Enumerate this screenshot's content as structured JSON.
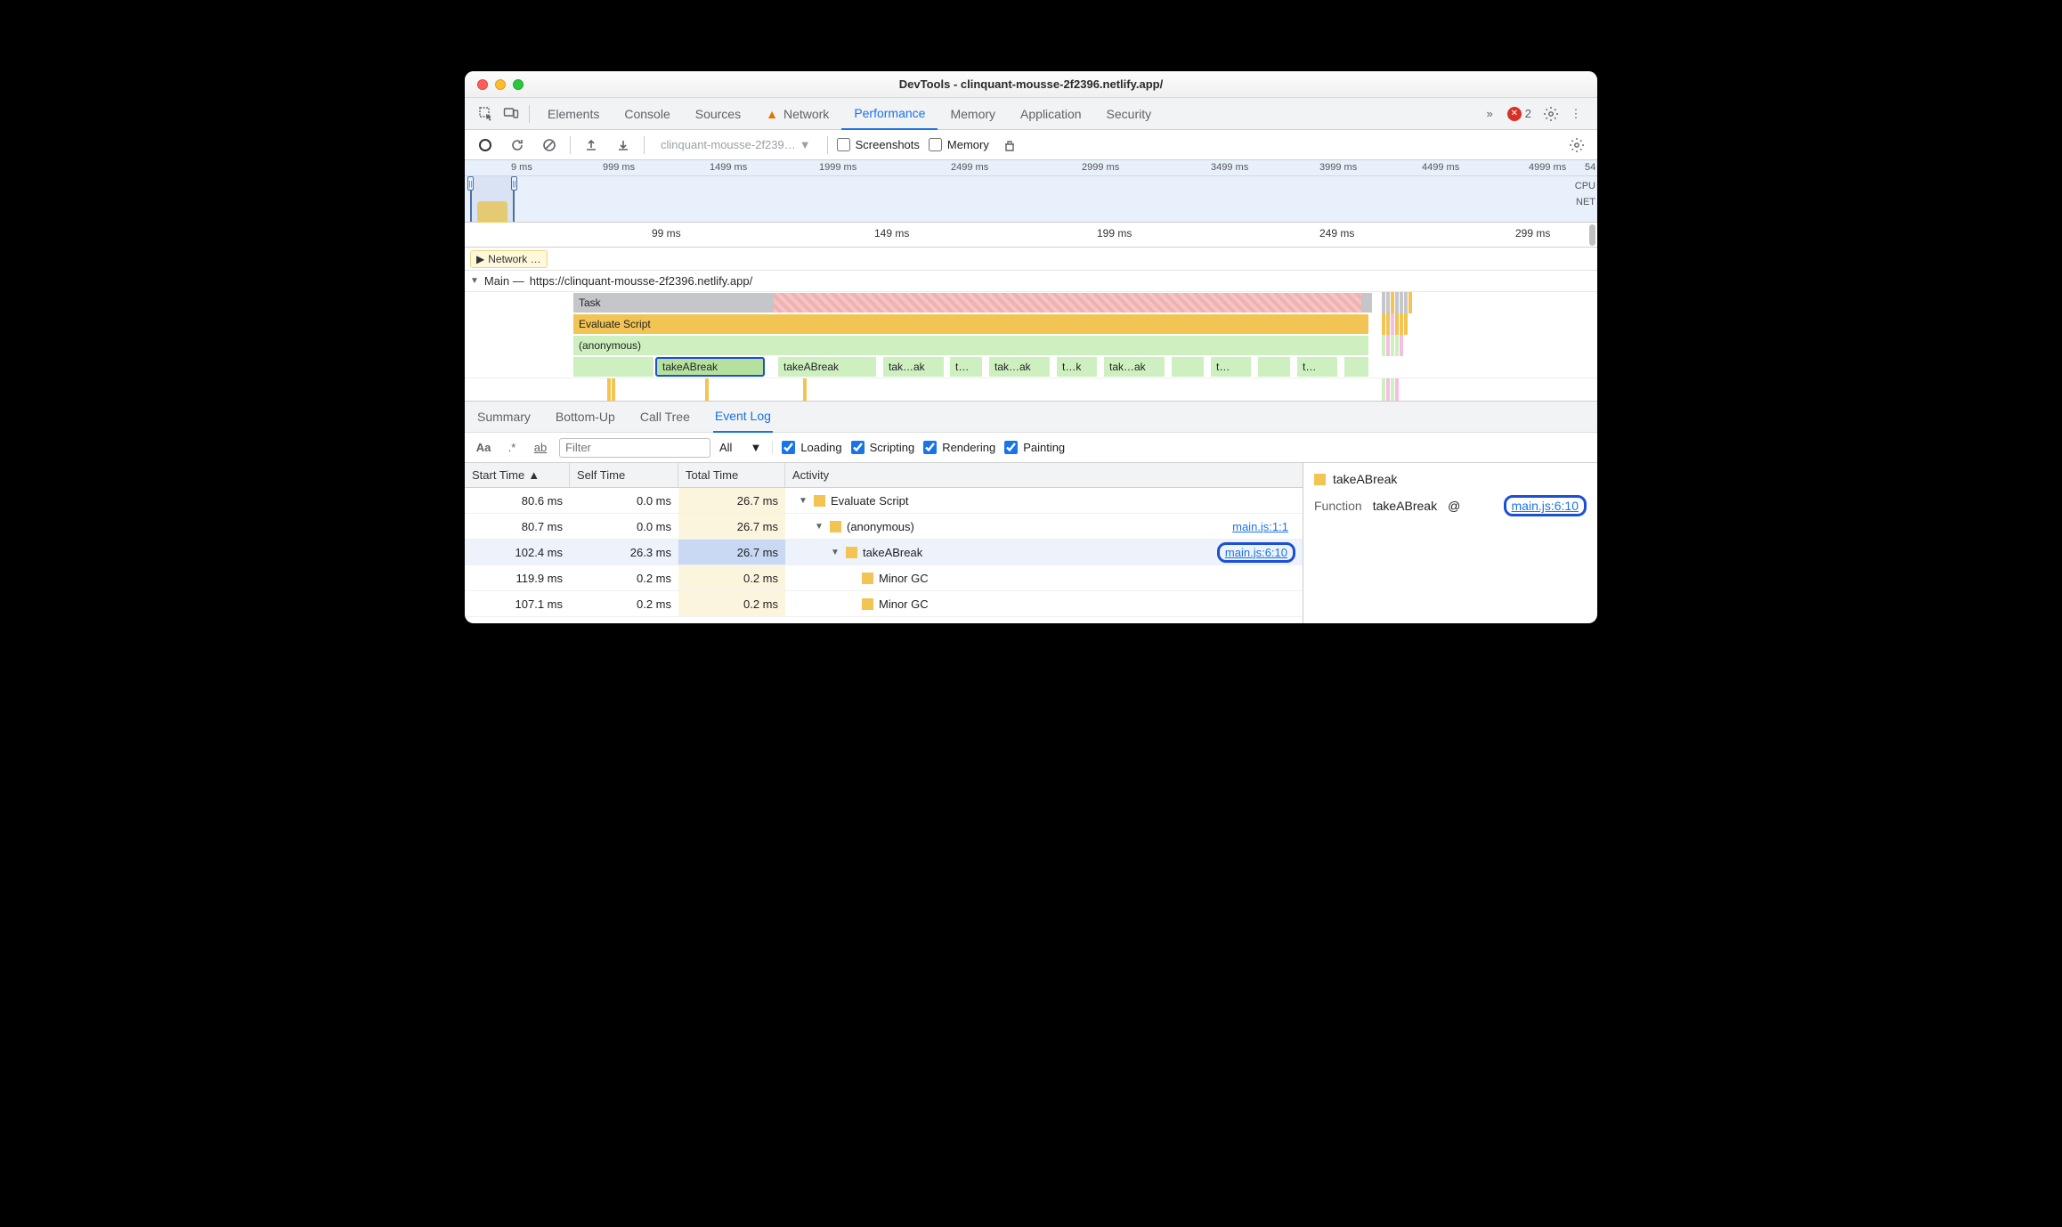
{
  "window": {
    "title": "DevTools - clinquant-mousse-2f2396.netlify.app/"
  },
  "tabs": {
    "items": [
      "Elements",
      "Console",
      "Sources",
      "Network",
      "Performance",
      "Memory",
      "Application",
      "Security"
    ],
    "network_has_warning": true,
    "active": "Performance",
    "overflow_glyph": "»",
    "error_count": "2"
  },
  "toolbar": {
    "recording_dropdown": "clinquant-mousse-2f239…",
    "screenshots_label": "Screenshots",
    "memory_label": "Memory"
  },
  "overview": {
    "ticks": [
      "9 ms",
      "999 ms",
      "1499 ms",
      "1999 ms",
      "2499 ms",
      "2999 ms",
      "3499 ms",
      "3999 ms",
      "4499 ms",
      "4999 ms",
      "54"
    ],
    "labels": [
      "CPU",
      "NET"
    ]
  },
  "detail_ruler": {
    "ticks": [
      "99 ms",
      "149 ms",
      "199 ms",
      "249 ms",
      "299 ms"
    ]
  },
  "network_track": {
    "label": "Network …"
  },
  "main_track": {
    "title_prefix": "Main —",
    "url": "https://clinquant-mousse-2f2396.netlify.app/",
    "rows": {
      "task": "Task",
      "eval": "Evaluate Script",
      "anon": "(anonymous)",
      "calls": [
        "takeABreak",
        "takeABreak",
        "tak…ak",
        "t…",
        "tak…ak",
        "t…k",
        "tak…ak",
        "t…",
        "t…"
      ]
    }
  },
  "subtabs": {
    "items": [
      "Summary",
      "Bottom-Up",
      "Call Tree",
      "Event Log"
    ],
    "active": "Event Log"
  },
  "filter": {
    "placeholder": "Filter",
    "scope": "All",
    "checks": [
      "Loading",
      "Scripting",
      "Rendering",
      "Painting"
    ]
  },
  "eventlog": {
    "headers": {
      "start": "Start Time",
      "self": "Self Time",
      "total": "Total Time",
      "activity": "Activity"
    },
    "rows": [
      {
        "start": "80.6 ms",
        "self": "0.0 ms",
        "total": "26.7 ms",
        "indent": 0,
        "expander": true,
        "label": "Evaluate Script",
        "link": ""
      },
      {
        "start": "80.7 ms",
        "self": "0.0 ms",
        "total": "26.7 ms",
        "indent": 1,
        "expander": true,
        "label": "(anonymous)",
        "link": "main.js:1:1"
      },
      {
        "start": "102.4 ms",
        "self": "26.3 ms",
        "total": "26.7 ms",
        "indent": 2,
        "expander": true,
        "label": "takeABreak",
        "link": "main.js:6:10",
        "selected": true,
        "link_hl": true
      },
      {
        "start": "119.9 ms",
        "self": "0.2 ms",
        "total": "0.2 ms",
        "indent": 3,
        "expander": false,
        "label": "Minor GC",
        "link": ""
      },
      {
        "start": "107.1 ms",
        "self": "0.2 ms",
        "total": "0.2 ms",
        "indent": 3,
        "expander": false,
        "label": "Minor GC",
        "link": ""
      }
    ]
  },
  "sidepanel": {
    "title": "takeABreak",
    "fn_label": "Function",
    "fn_name": "takeABreak",
    "fn_at": "@",
    "fn_link": "main.js:6:10"
  }
}
